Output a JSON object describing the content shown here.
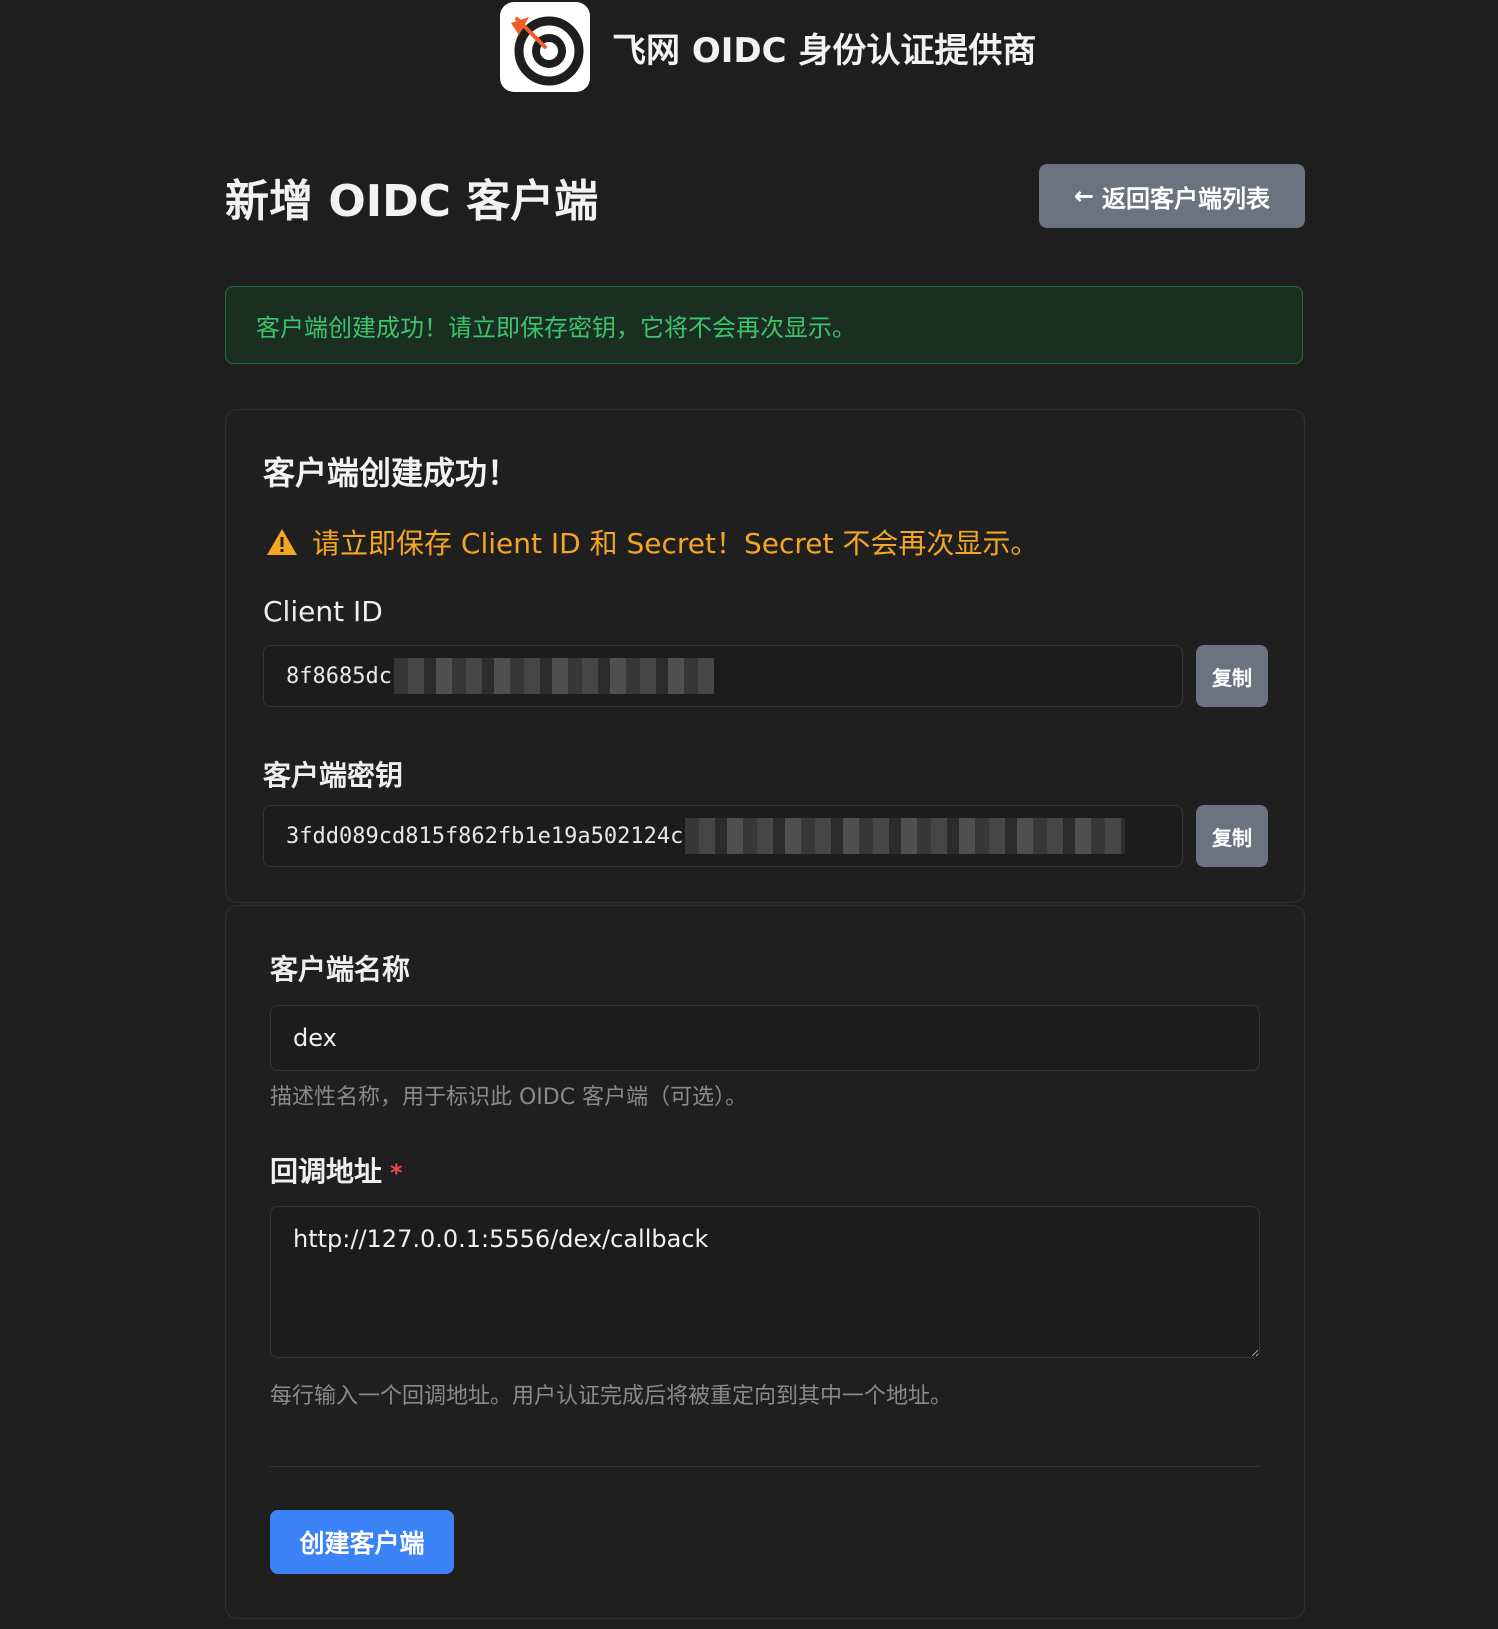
{
  "header": {
    "brand_title": "飞网 OIDC 身份认证提供商",
    "logo_icon": "target-arrow-icon"
  },
  "page": {
    "title": "新增 OIDC 客户端",
    "back_label": "返回客户端列表",
    "back_icon": "arrow-left-icon"
  },
  "alert": {
    "message": "客户端创建成功！请立即保存密钥，它将不会再次显示。"
  },
  "credentials": {
    "heading": "客户端创建成功！",
    "warning": "请立即保存 Client ID 和 Secret！Secret 不会再次显示。",
    "client_id_label": "Client ID",
    "client_id_value": "8f8685dc",
    "client_secret_label": "客户端密钥",
    "client_secret_value": "3fdd089cd815f862fb1e19a502124c",
    "copy_label": "复制"
  },
  "form": {
    "name_label": "客户端名称",
    "name_value": "dex",
    "name_help": "描述性名称，用于标识此 OIDC 客户端（可选）。",
    "redirect_label": "回调地址",
    "redirect_required": "*",
    "redirect_value": "http://127.0.0.1:5556/dex/callback",
    "redirect_help": "每行输入一个回调地址。用户认证完成后将被重定向到其中一个地址。",
    "submit_label": "创建客户端"
  },
  "colors": {
    "background": "#1e1e1e",
    "success": "#3cc46c",
    "warning": "#f5a524",
    "primary": "#3b82f6",
    "secondary": "#6c7280",
    "required": "#e5484d"
  }
}
